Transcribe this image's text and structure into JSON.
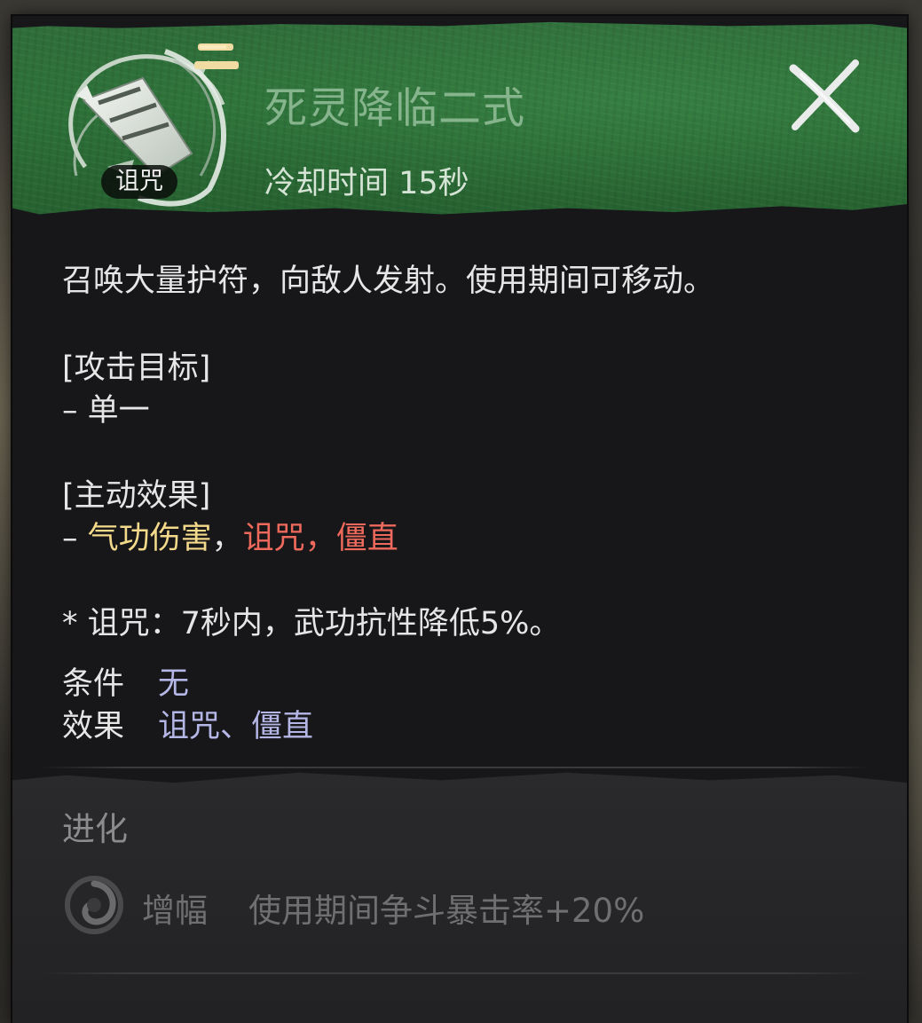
{
  "skill": {
    "name": "死灵降临二式",
    "grade_glyph": "二",
    "type_tag": "诅咒",
    "cooldown": "冷却时间 15秒",
    "icon": "talisman-scroll-icon"
  },
  "description": "召唤大量护符，向敌人发射。使用期间可移动。",
  "attack_target": {
    "header": "[攻击目标]",
    "dash": "– ",
    "value": "单一"
  },
  "active_effect": {
    "header": "[主动效果]",
    "dash": "– ",
    "item1": "气功伤害",
    "sep1": "，",
    "item2": "诅咒",
    "sep2": "，",
    "item3": "僵直"
  },
  "curse_note": "* 诅咒：7秒内，武功抗性降低5%。",
  "condition": {
    "label": "条件",
    "value": "无"
  },
  "effect": {
    "label": "效果",
    "value": "诅咒、僵直"
  },
  "evolution": {
    "title": "进化",
    "name": "增幅",
    "desc": "使用期间争斗暴击率+20%",
    "icon": "swirl-icon"
  },
  "close_icon": "close-icon",
  "colors": {
    "header_green": "#2d7139",
    "skill_name": "#86b48c",
    "highlight_yellow": "#f3d98a",
    "highlight_red": "#ef6a5c",
    "value_purple": "#b4b7e6",
    "evo_text": "#6f6f72"
  }
}
